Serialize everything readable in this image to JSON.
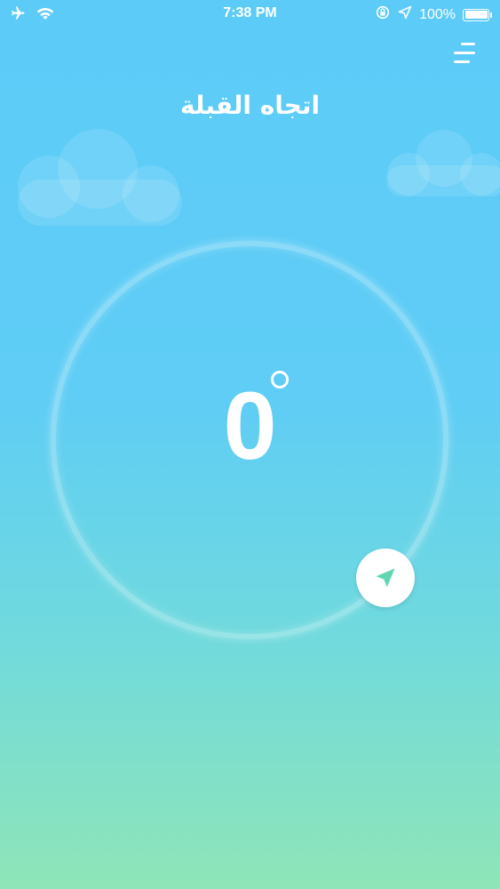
{
  "status_bar": {
    "time": "7:38 PM",
    "battery_percent": "100%",
    "battery_level": 1.0,
    "icons": [
      "airplane-icon",
      "wifi-icon",
      "rotation-lock-icon",
      "location-arrow-icon",
      "battery-icon"
    ]
  },
  "header": {
    "title": "اتجاه القبلة",
    "menu_icon": "menu-icon"
  },
  "compass": {
    "degrees": "0",
    "degree_symbol_icon": "degree-circle-icon",
    "locate_icon": "navigation-arrow-icon",
    "accent_color": "#5fd6b1"
  },
  "colors": {
    "background_top": "#5ccbf8",
    "background_bottom": "#8ee5b7",
    "text": "#ffffff"
  }
}
